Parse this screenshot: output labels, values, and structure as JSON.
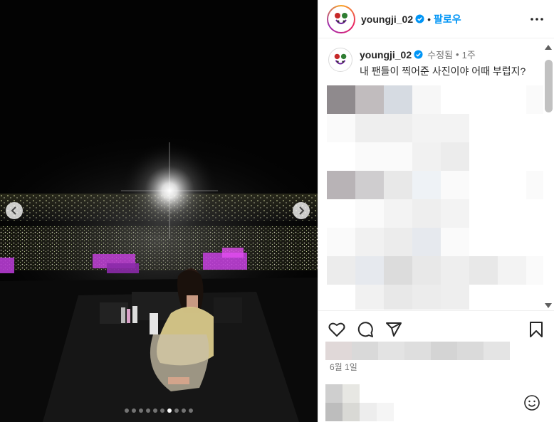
{
  "post": {
    "username": "youngji_02",
    "follow_separator": "•",
    "follow_label": "팔로우",
    "caption": {
      "username": "youngji_02",
      "edited_label": "수정됨",
      "separator": "•",
      "time_ago": "1주",
      "text": "내 팬들이 찍어준 사진이야 어때 부럽지?"
    },
    "date": "6월 1일"
  },
  "carousel": {
    "total_slides": 10,
    "active_index": 6
  },
  "icons": {
    "verified": "verified-badge-icon",
    "more": "more-options-icon",
    "like": "heart-icon",
    "comment": "comment-icon",
    "share": "send-icon",
    "save": "bookmark-icon",
    "emoji": "emoji-icon",
    "prev": "chevron-left-icon",
    "next": "chevron-right-icon"
  },
  "colors": {
    "accent": "#0095f6",
    "verified": "#0095f6",
    "text_secondary": "#737373"
  }
}
